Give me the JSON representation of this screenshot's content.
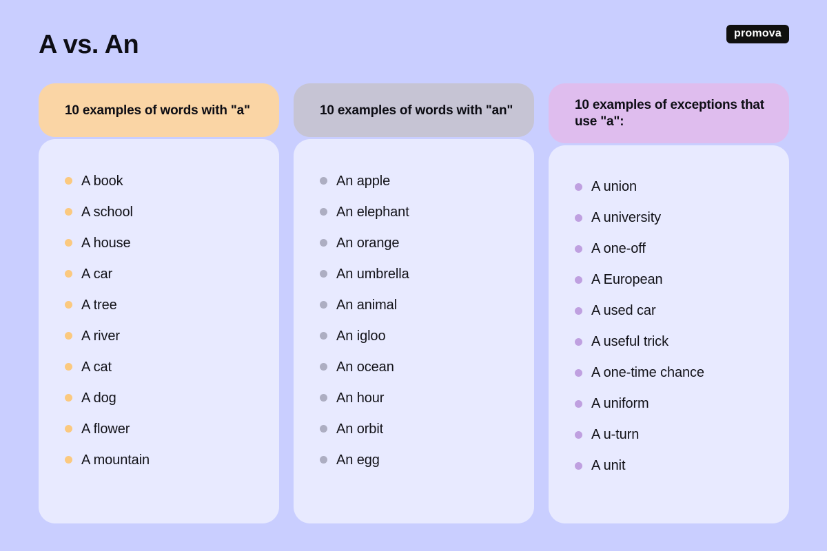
{
  "header": {
    "title": "A vs. An",
    "logo": "promova"
  },
  "theme": {
    "page_background": "#c9ceff",
    "card_body_background": "#e8eaff",
    "text_color": "#121218",
    "logo_background": "#10100f",
    "logo_text_color": "#ffffff"
  },
  "columns": [
    {
      "id": "words-with-a",
      "header": "10 examples of words with \"a\"",
      "header_background": "#fad5a5",
      "bullet_color": "#fbc97f",
      "items": [
        "A book",
        "A school",
        "A house",
        "A car",
        "A tree",
        "A river",
        "A cat",
        "A dog",
        "A flower",
        "A mountain"
      ]
    },
    {
      "id": "words-with-an",
      "header": "10 examples of words with \"an\"",
      "header_background": "#c6c4d4",
      "bullet_color": "#adaec2",
      "items": [
        "An apple",
        "An elephant",
        "An orange",
        "An umbrella",
        "An animal",
        "An igloo",
        "An ocean",
        "An hour",
        "An orbit",
        "An egg"
      ]
    },
    {
      "id": "exceptions-with-a",
      "header": "10 examples of exceptions that use \"a\":",
      "header_background": "#dfbdee",
      "bullet_color": "#bfa0e0",
      "items": [
        "A union",
        "A university",
        "A one-off",
        "A European",
        "A used car",
        "A useful trick",
        "A one-time chance",
        "A uniform",
        "A u-turn",
        "A unit"
      ]
    }
  ]
}
